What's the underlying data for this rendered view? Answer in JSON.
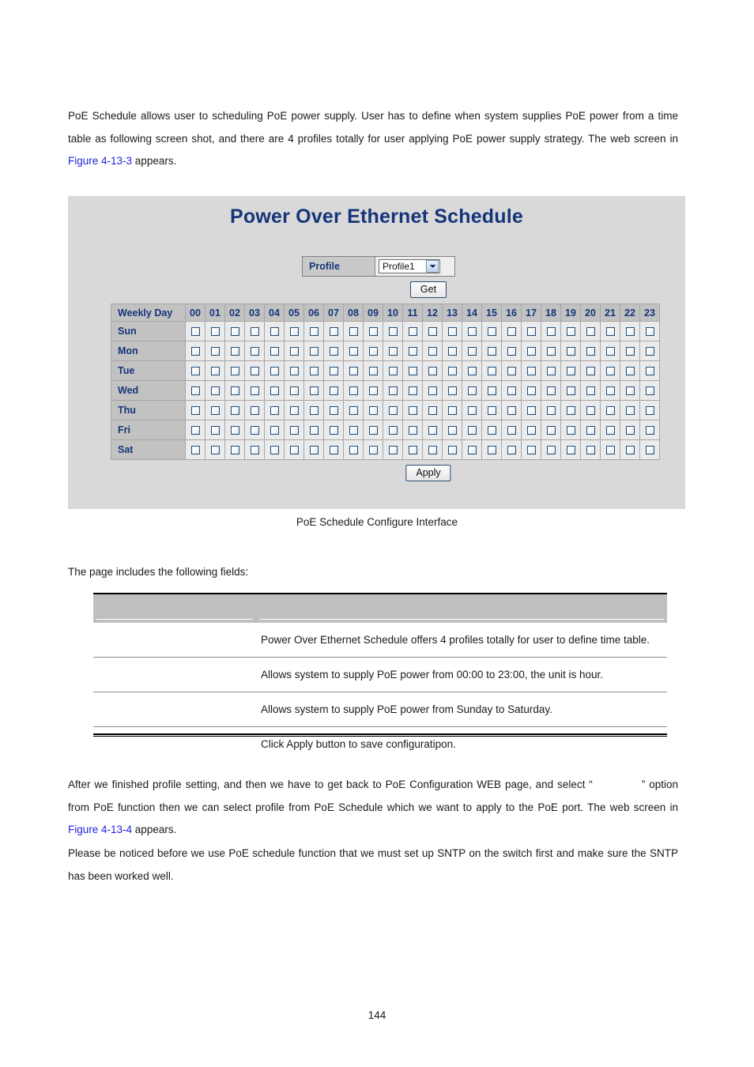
{
  "document": {
    "page_number": "144",
    "intro_paragraph": "PoE Schedule allows user to scheduling PoE power supply. User has to define when system supplies PoE power from a time table as following screen shot, and there are 4 profiles totally for user applying PoE power supply strategy. The web screen in ",
    "intro_link": "Figure 4-13-3",
    "intro_paragraph_tail": " appears.",
    "figure_caption": "PoE Schedule Configure Interface",
    "fields_intro": "The page includes the following fields:",
    "after_paragraph_head": "After we finished profile setting, and then we have to get back to PoE Configuration WEB page, and select “",
    "after_paragraph_quoted": "",
    "after_paragraph_mid": "” option from PoE function then we can select profile from PoE Schedule which we want to apply to the PoE port. The web screen in ",
    "after_link": "Figure 4-13-4",
    "after_paragraph_tail": " appears.",
    "note_paragraph": "Please be noticed before we use PoE schedule function that we must set up SNTP on the switch first and make sure the SNTP has been worked well."
  },
  "screenshot": {
    "title": "Power Over Ethernet Schedule",
    "profile": {
      "label": "Profile",
      "selected_value": "Profile1",
      "dropdown_icon": "chevron-down-icon"
    },
    "get_button_label": "Get",
    "apply_button_label": "Apply",
    "schedule": {
      "day_column_header": "Weekly Day",
      "hours": [
        "00",
        "01",
        "02",
        "03",
        "04",
        "05",
        "06",
        "07",
        "08",
        "09",
        "10",
        "11",
        "12",
        "13",
        "14",
        "15",
        "16",
        "17",
        "18",
        "19",
        "20",
        "21",
        "22",
        "23"
      ],
      "days": [
        "Sun",
        "Mon",
        "Tue",
        "Wed",
        "Thu",
        "Fri",
        "Sat"
      ],
      "checked_cells": []
    }
  },
  "description_table": {
    "headers": {
      "object": "",
      "description": ""
    },
    "rows": [
      {
        "object": "",
        "description": "Power Over Ethernet Schedule offers 4 profiles totally for user to define time table."
      },
      {
        "object": "",
        "description": "Allows system to supply PoE power from 00:00 to 23:00, the unit is hour."
      },
      {
        "object": "",
        "description": "Allows system to supply PoE power from Sunday to Saturday."
      },
      {
        "object": "",
        "description": "Click Apply button to save configuratipon."
      }
    ]
  },
  "colors": {
    "panel_background": "#d9d9d9",
    "title_blue": "#15357a",
    "header_gray": "#c2c2c2",
    "cell_gray": "#ebebeb",
    "link_blue": "#2222dd",
    "checkbox_border": "#1f4e79"
  }
}
